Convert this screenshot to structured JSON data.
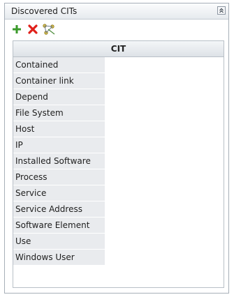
{
  "panel": {
    "title": "Discovered CITs"
  },
  "toolbar": {
    "buttons": [
      {
        "name": "add-icon"
      },
      {
        "name": "delete-icon"
      },
      {
        "name": "topology-icon"
      }
    ]
  },
  "grid": {
    "column_header": "CIT",
    "rows": [
      "Contained",
      "Container link",
      "Depend",
      "File System",
      "Host",
      "IP",
      "Installed Software",
      "Process",
      "Service",
      "Service Address",
      "Software Element",
      "Use",
      "Windows User"
    ]
  },
  "colors": {
    "add": "#3a9a2a",
    "delete": "#e0201a",
    "row_bg": "#e9ebee"
  }
}
